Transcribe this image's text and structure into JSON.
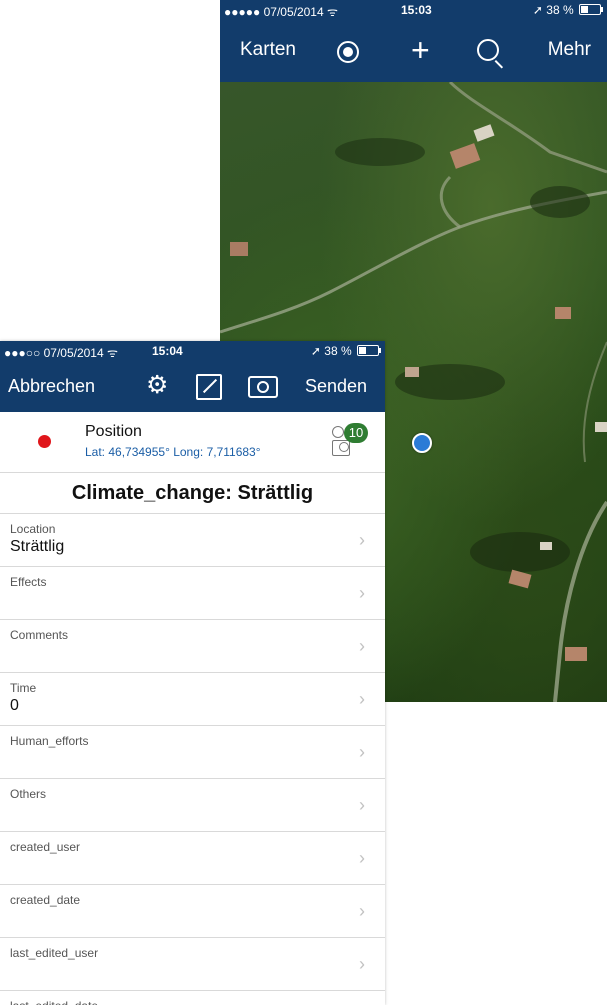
{
  "back_screen": {
    "status_bar": {
      "signal": "●●●●●",
      "date": "07/05/2014",
      "wifi": "ᯤ",
      "time": "15:03",
      "location_arrow": "➚",
      "battery": "38 %"
    },
    "nav": {
      "maps_label": "Karten",
      "more_label": "Mehr",
      "icons": [
        "location-target-icon",
        "plus-icon",
        "search-icon"
      ]
    }
  },
  "front_screen": {
    "status_bar": {
      "signal": "●●●○○",
      "date": "07/05/2014",
      "wifi": "ᯤ",
      "time": "15:04",
      "location_arrow": "➚",
      "battery": "38 %"
    },
    "nav": {
      "cancel_label": "Abbrechen",
      "send_label": "Senden",
      "gear_glyph": "⚙",
      "icons": [
        "gear-icon",
        "sketch-icon",
        "camera-icon"
      ]
    },
    "position": {
      "title": "Position",
      "coords": "Lat: 46,734955° Long: 7,711683°",
      "attachments_count": "10",
      "status_color": "#e0161b"
    },
    "form_title": "Climate_change: Strättlig",
    "fields": [
      {
        "label": "Location",
        "value": "Strättlig"
      },
      {
        "label": "Effects",
        "value": ""
      },
      {
        "label": "Comments",
        "value": ""
      },
      {
        "label": "Time",
        "value": "0"
      },
      {
        "label": "Human_efforts",
        "value": ""
      },
      {
        "label": "Others",
        "value": ""
      },
      {
        "label": "created_user",
        "value": ""
      },
      {
        "label": "created_date",
        "value": ""
      },
      {
        "label": "last_edited_user",
        "value": ""
      },
      {
        "label": "last_edited_date",
        "value": ""
      }
    ],
    "chevron": "›"
  },
  "colors": {
    "nav_blue": "#123c6b",
    "badge_green": "#2f7d32",
    "location_dot": "#2b7bd6"
  }
}
